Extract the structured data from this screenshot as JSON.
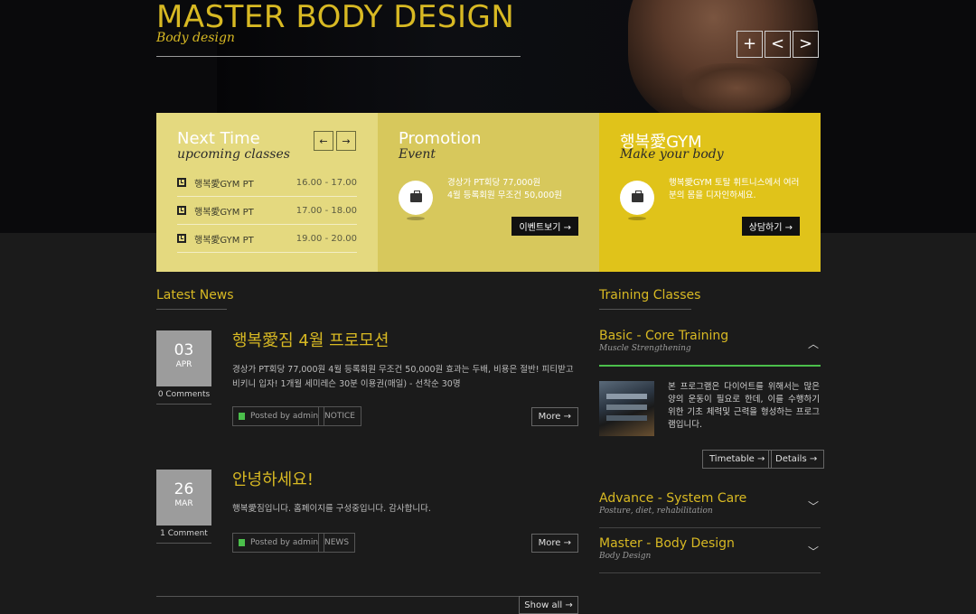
{
  "hero": {
    "title": "MASTER BODY DESIGN",
    "subtitle": "Body design",
    "controls": [
      "+",
      "<",
      ">"
    ]
  },
  "panels": {
    "next": {
      "title": "Next Time",
      "subtitle": "upcoming classes",
      "prev": "←",
      "next": "→",
      "classes": [
        {
          "name": "행복愛GYM PT",
          "time": "16.00 - 17.00"
        },
        {
          "name": "행복愛GYM PT",
          "time": "17.00 - 18.00"
        },
        {
          "name": "행복愛GYM PT",
          "time": "19.00 - 20.00"
        }
      ]
    },
    "promotion": {
      "title": "Promotion",
      "subtitle": "Event",
      "text_line1": "경상가 PT회당 77,000원",
      "text_line2": "4월 등록회원 무조건 50,000원",
      "button": "이벤트보기 →"
    },
    "gym": {
      "title": "행복愛GYM",
      "subtitle": "Make your body",
      "text": "행복愛GYM 토탈 휘트니스에서 여러분의 몸을 디자인하세요.",
      "button": "상담하기 →"
    }
  },
  "news": {
    "heading": "Latest News",
    "show_all": "Show all →",
    "items": [
      {
        "day": "03",
        "month": "APR",
        "comments": "0 Comments",
        "title": "행복愛짐 4월 프로모션",
        "body": "경상가 PT회당 77,000원 4월 등록회원 무조건 50,000원   효과는 두배, 비용은 절반! 피티받고 비키니 입자! 1개월  세미레슨 30분 이용권(매일) - 선착순 30명",
        "author": "Posted by admin",
        "category": "NOTICE",
        "more": "More →"
      },
      {
        "day": "26",
        "month": "MAR",
        "comments": "1 Comment",
        "title": "안녕하세요!",
        "body": "행복愛짐입니다. 홈페이지를 구성중입니다. 감사합니다.",
        "author": "Posted by admin",
        "category": "NEWS",
        "more": "More →"
      }
    ]
  },
  "training": {
    "heading": "Training Classes",
    "items": [
      {
        "title": "Basic - Core Training",
        "subtitle": "Muscle Strengthening",
        "chev": "︿"
      },
      {
        "title": "Advance - System Care",
        "subtitle": "Posture, diet, rehabilitation",
        "chev": "﹀"
      },
      {
        "title": "Master - Body Design",
        "subtitle": "Body Design",
        "chev": "﹀"
      }
    ],
    "open_text": "본 프로그램은 다이어트를 위해서는 많은양의 운동이 필요로 한데, 이를 수행하기 위한 기초 체력및 근력을 형성하는 프로그램입니다.",
    "timetable": "Timetable →",
    "details": "Details →"
  },
  "colors": {
    "accent": "#d8b923",
    "panel1": "#e4d97f",
    "panel2": "#d7c85c",
    "panel3": "#e0c31a"
  }
}
